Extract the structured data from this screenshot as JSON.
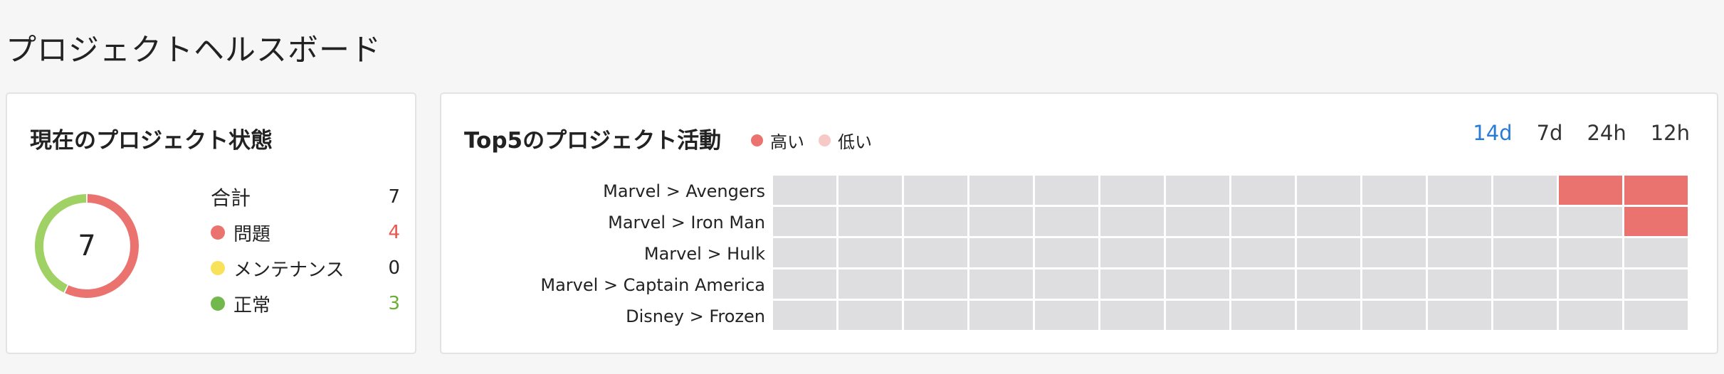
{
  "page": {
    "title": "プロジェクトヘルスボード"
  },
  "status": {
    "title": "現在のプロジェクト状態",
    "total_value": "7",
    "legend": [
      {
        "label": "合計",
        "value": "7",
        "dot": null,
        "value_color": "#222222",
        "kind": "total"
      },
      {
        "label": "問題",
        "value": "4",
        "dot": "#ea7370",
        "value_color": "#ea5550"
      },
      {
        "label": "メンテナンス",
        "value": "0",
        "dot": "#f7e25a",
        "value_color": "#222222"
      },
      {
        "label": "正常",
        "value": "3",
        "dot": "#72b84c",
        "value_color": "#6aaf34"
      }
    ],
    "donut": [
      {
        "name": "問題",
        "value": 4,
        "color": "#ea7370"
      },
      {
        "name": "正常",
        "value": 3,
        "color": "#9fd164"
      }
    ]
  },
  "activity": {
    "title": "Top5のプロジェクト活動",
    "legend": [
      {
        "label": "高い",
        "color": "#ea7370"
      },
      {
        "label": "低い",
        "color": "#f6c9c7"
      }
    ],
    "ranges": [
      {
        "label": "14d",
        "active": true
      },
      {
        "label": "7d",
        "active": false
      },
      {
        "label": "24h",
        "active": false
      },
      {
        "label": "12h",
        "active": false
      }
    ],
    "colors": {
      "empty": "#dedee0",
      "high": "#ea7370",
      "low": "#f6c9c7"
    },
    "rows": [
      {
        "label": "Marvel > Avengers",
        "cells": [
          0,
          0,
          0,
          0,
          0,
          0,
          0,
          0,
          0,
          0,
          0,
          0,
          2,
          2
        ]
      },
      {
        "label": "Marvel > Iron Man",
        "cells": [
          0,
          0,
          0,
          0,
          0,
          0,
          0,
          0,
          0,
          0,
          0,
          0,
          0,
          2
        ]
      },
      {
        "label": "Marvel > Hulk",
        "cells": [
          0,
          0,
          0,
          0,
          0,
          0,
          0,
          0,
          0,
          0,
          0,
          0,
          0,
          0
        ]
      },
      {
        "label": "Marvel > Captain America",
        "cells": [
          0,
          0,
          0,
          0,
          0,
          0,
          0,
          0,
          0,
          0,
          0,
          0,
          0,
          0
        ]
      },
      {
        "label": "Disney > Frozen",
        "cells": [
          0,
          0,
          0,
          0,
          0,
          0,
          0,
          0,
          0,
          0,
          0,
          0,
          0,
          0
        ]
      }
    ]
  }
}
